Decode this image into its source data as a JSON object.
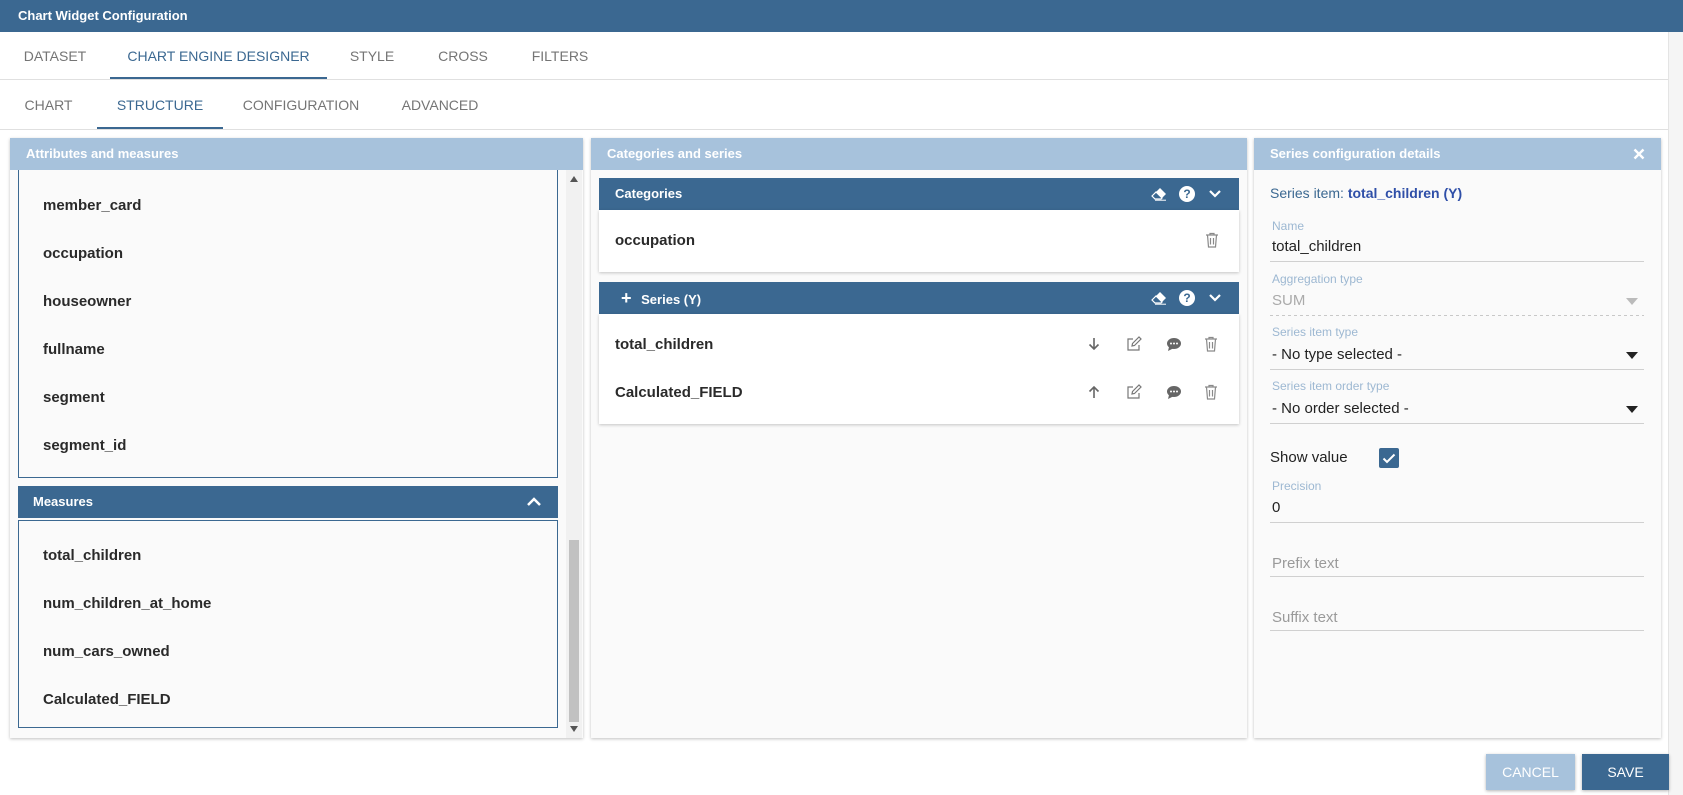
{
  "window": {
    "title": "Chart Widget Configuration"
  },
  "main_tabs": [
    {
      "label": "DATASET"
    },
    {
      "label": "CHART ENGINE DESIGNER"
    },
    {
      "label": "STYLE"
    },
    {
      "label": "CROSS"
    },
    {
      "label": "FILTERS"
    }
  ],
  "sub_tabs": [
    {
      "label": "CHART"
    },
    {
      "label": "STRUCTURE"
    },
    {
      "label": "CONFIGURATION"
    },
    {
      "label": "ADVANCED"
    }
  ],
  "attributes_panel": {
    "title": "Attributes and measures",
    "attributes": [
      "member_card",
      "occupation",
      "houseowner",
      "fullname",
      "segment",
      "segment_id"
    ],
    "measures_title": "Measures",
    "measures": [
      "total_children",
      "num_children_at_home",
      "num_cars_owned",
      "Calculated_FIELD"
    ]
  },
  "categories_panel": {
    "title": "Categories and series",
    "categories_title": "Categories",
    "categories": [
      "occupation"
    ],
    "series_title": "Series (Y)",
    "series": [
      "total_children",
      "Calculated_FIELD"
    ]
  },
  "details_panel": {
    "title": "Series configuration details",
    "series_item_prefix": "Series item:",
    "series_item_value": "total_children (Y)",
    "name_label": "Name",
    "name_value": "total_children",
    "aggregation_label": "Aggregation type",
    "aggregation_value": "SUM",
    "item_type_label": "Series item type",
    "item_type_value": "- No type selected -",
    "order_type_label": "Series item order type",
    "order_type_value": "- No order selected -",
    "show_value_label": "Show value",
    "show_value_checked": true,
    "precision_label": "Precision",
    "precision_value": "0",
    "prefix_placeholder": "Prefix text",
    "suffix_placeholder": "Suffix text"
  },
  "footer": {
    "cancel_label": "CANCEL",
    "save_label": "SAVE"
  },
  "colors": {
    "primary": "#3b6891",
    "header_light": "#a7c2dc",
    "label_blue": "#9db8d2"
  }
}
